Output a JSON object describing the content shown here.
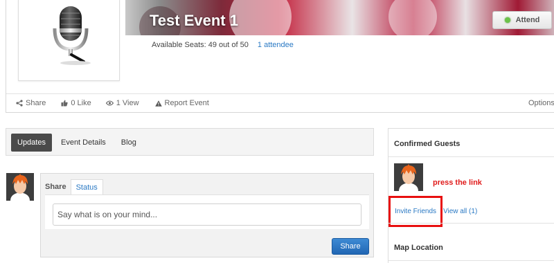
{
  "event": {
    "title": "Test Event 1",
    "attend_label": "Attend",
    "seats_text": "Available Seats: 49 out of 50",
    "attendee_link": "1 attendee",
    "colors": {
      "attend_dot": "#6cc24a",
      "link": "#2a79c4",
      "highlight": "#e80f0f"
    }
  },
  "actions": {
    "share": "Share",
    "like": "0 Like",
    "view": "1 View",
    "report": "Report Event",
    "options": "Options"
  },
  "tabs": [
    {
      "label": "Updates",
      "active": true
    },
    {
      "label": "Event Details",
      "active": false
    },
    {
      "label": "Blog",
      "active": false
    }
  ],
  "share_box": {
    "label": "Share",
    "status_tab": "Status",
    "placeholder": "Say what is on your mind...",
    "button": "Share"
  },
  "sidebar": {
    "confirmed_title": "Confirmed Guests",
    "annotation": "press the link",
    "invite_link": "Invite Friends",
    "view_all_link": "View all (1)",
    "map_title": "Map Location"
  },
  "icons": {
    "event_image": "microphone-icon",
    "share": "share-icon",
    "like": "thumbs-up-icon",
    "view": "eye-icon",
    "report": "warning-icon",
    "status": "green-dot-icon"
  }
}
